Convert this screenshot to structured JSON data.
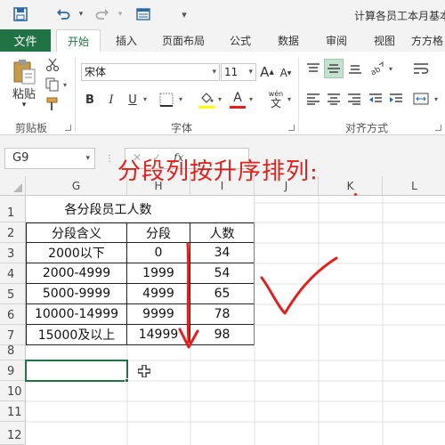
{
  "window": {
    "title": "计算各员工本月基本"
  },
  "quick_access": {
    "save_icon": "save-icon",
    "undo_icon": "undo-icon",
    "redo_icon": "redo-icon",
    "form_icon": "form-icon",
    "customize_icon": "customize-icon"
  },
  "tabs": [
    {
      "label": "文件"
    },
    {
      "label": "开始"
    },
    {
      "label": "插入"
    },
    {
      "label": "页面布局"
    },
    {
      "label": "公式"
    },
    {
      "label": "数据"
    },
    {
      "label": "审阅"
    },
    {
      "label": "视图"
    },
    {
      "label": "方方格"
    }
  ],
  "ribbon": {
    "clipboard": {
      "paste_label": "粘贴",
      "group_label": "剪贴板"
    },
    "font": {
      "font_name": "宋体",
      "font_size": "11",
      "bold": "B",
      "italic": "I",
      "underline": "U",
      "group_label": "字体",
      "fill_color": "#ffff00",
      "font_color": "#e0201c",
      "phonetic": "wén"
    },
    "alignment": {
      "group_label": "对齐方式"
    }
  },
  "formula_bar": {
    "name_box": "G9",
    "fx": "fx",
    "cancel": "✕",
    "enter": "✓",
    "formula": ""
  },
  "grid": {
    "columns": [
      "G",
      "H",
      "I",
      "J",
      "K",
      "L"
    ],
    "rows": [
      "1",
      "2",
      "3",
      "4",
      "5",
      "6",
      "7",
      "8",
      "9",
      "10",
      "11",
      "12"
    ],
    "table_title": "各分段员工人数",
    "headers": [
      "分段含义",
      "分段",
      "人数"
    ],
    "data": [
      [
        "2000以下",
        "0",
        "34"
      ],
      [
        "2000-4999",
        "1999",
        "54"
      ],
      [
        "5000-9999",
        "4999",
        "65"
      ],
      [
        "10000-14999",
        "9999",
        "78"
      ],
      [
        "15000及以上",
        "14999",
        "98"
      ]
    ]
  },
  "annotation": {
    "text": "分段列按升序排列:",
    "color": "#e0201c"
  },
  "accent": "#217346"
}
